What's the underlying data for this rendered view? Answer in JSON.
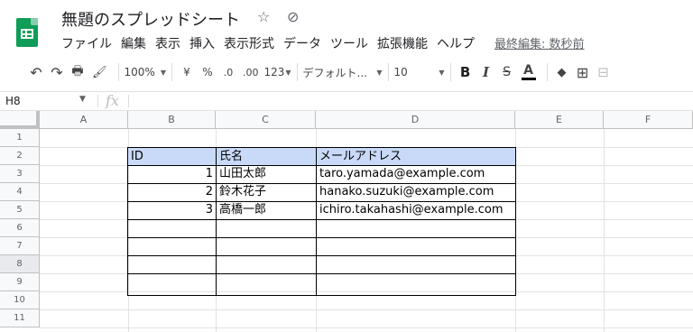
{
  "app": {
    "title": "無題のスプレッドシート",
    "star_icon": "☆",
    "cloud_icon": "⊘"
  },
  "menu": {
    "items": [
      "ファイル",
      "編集",
      "表示",
      "挿入",
      "表示形式",
      "データ",
      "ツール",
      "拡張機能",
      "ヘルプ"
    ],
    "last_edit": "最終編集: 数秒前"
  },
  "toolbar": {
    "undo": "↶",
    "redo": "↷",
    "print": "🖶",
    "paint_format": "🖌",
    "zoom": "100%",
    "currency": "¥",
    "percent": "%",
    "decrease_decimal": ".0",
    "increase_decimal": ".00",
    "more_formats": "123",
    "font": "デフォルト...",
    "font_size": "10",
    "bold": "B",
    "italic": "I",
    "strikethrough": "S",
    "text_color": "A",
    "fill_color": "◆",
    "borders": "⊞",
    "merge": "⊟"
  },
  "formula_bar": {
    "cell_ref": "H8",
    "fx": "fx",
    "value": ""
  },
  "grid": {
    "columns": [
      "A",
      "B",
      "C",
      "D",
      "E",
      "F"
    ],
    "rows": [
      "1",
      "2",
      "3",
      "4",
      "5",
      "6",
      "7",
      "8",
      "9",
      "10",
      "11"
    ],
    "active_row": "8"
  },
  "sheet": {
    "headers": [
      "ID",
      "氏名",
      "メールアドレス"
    ],
    "rows": [
      {
        "id": "1",
        "name": "山田太郎",
        "email": "taro.yamada@example.com"
      },
      {
        "id": "2",
        "name": "鈴木花子",
        "email": "hanako.suzuki@example.com"
      },
      {
        "id": "3",
        "name": "高橋一郎",
        "email": "ichiro.takahashi@example.com"
      }
    ],
    "header_color": "#c9daf8"
  }
}
